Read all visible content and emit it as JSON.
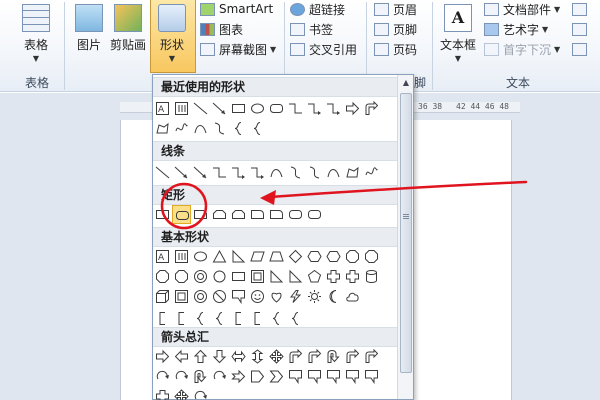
{
  "ribbon": {
    "table": {
      "label": "表格"
    },
    "picture": {
      "label": "图片"
    },
    "clipart": {
      "label": "剪贴画"
    },
    "shapes": {
      "label": "形状"
    },
    "smartart": {
      "label": "SmartArt"
    },
    "chart": {
      "label": "图表"
    },
    "screenshot": {
      "label": "屏幕截图"
    },
    "hyperlink": {
      "label": "超链接"
    },
    "bookmark": {
      "label": "书签"
    },
    "crossref": {
      "label": "交叉引用"
    },
    "header": {
      "label": "页眉"
    },
    "footer": {
      "label": "页脚"
    },
    "pagenum": {
      "label": "页码"
    },
    "textbox": {
      "label": "文本框"
    },
    "docparts": {
      "label": "文档部件"
    },
    "wordart": {
      "label": "艺术字"
    },
    "dropcap": {
      "label": "首字下沉"
    },
    "groups": {
      "table": "表格",
      "headerfooter": "脚",
      "text": "文本"
    }
  },
  "ruler": {
    "marks": "36 38",
    "marks2": "42 44 46 48"
  },
  "dropdown": {
    "sections": {
      "recent": "最近使用的形状",
      "lines": "线条",
      "rect": "矩形",
      "basic": "基本形状",
      "arrows": "箭头总汇"
    }
  },
  "colors": {
    "accent": "#f8c760",
    "annotation": "#e0141e",
    "ribbon_border": "#c5d2e2"
  }
}
